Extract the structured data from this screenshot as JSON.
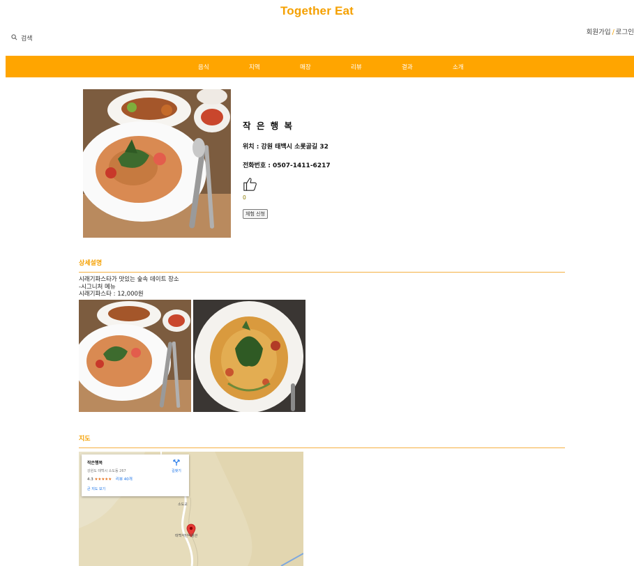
{
  "header": {
    "site_title": "Together Eat",
    "search_label": "검색",
    "signup_label": "회원가입",
    "auth_separator": "/",
    "login_label": "로그인"
  },
  "nav": {
    "items": [
      "음식",
      "지역",
      "매장",
      "리뷰",
      "결과",
      "소개"
    ]
  },
  "restaurant": {
    "name": "작 은 행 복",
    "location": "위치 : 강원 태백시 소롯골길 32",
    "phone": "전화번호 : 0507-1411-6217",
    "like_count": "0",
    "apply_button": "체험 신청"
  },
  "detail": {
    "section_title": "상세설명",
    "lines": [
      "시래기파스타가 맛있는 숲속 데이트 장소",
      "-시그니처 메뉴",
      "시래기파스타 : 12,000원"
    ]
  },
  "map": {
    "section_title": "지도",
    "card_name": "작은행복",
    "card_address": "강원도 태백시 소도동 267",
    "card_rating": "4.3",
    "card_stars": "★★★★★",
    "card_reviews": "리뷰 40개",
    "card_big_map": "큰 지도 보기",
    "card_directions": "길찾기",
    "road_label_1": "소도교",
    "pin_label": "태백석탄박물관"
  },
  "colors": {
    "accent": "#ffa500",
    "title": "#f5a000"
  },
  "icons": {
    "search": "search-icon",
    "like": "thumbs-up-icon",
    "map_pin": "map-pin-icon",
    "directions": "directions-icon"
  }
}
